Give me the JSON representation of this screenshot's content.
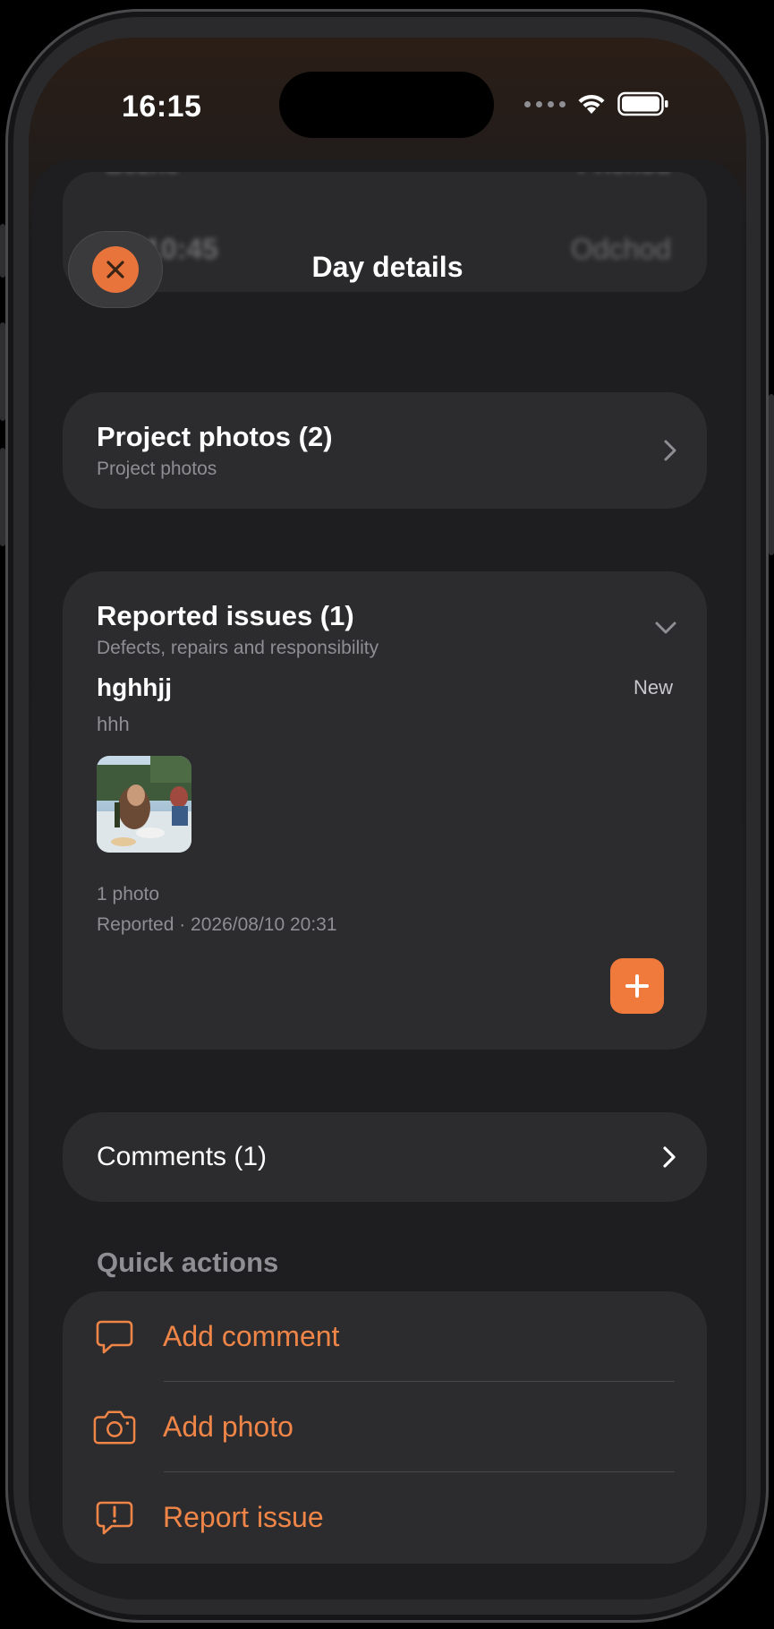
{
  "status_bar": {
    "time": "16:15"
  },
  "background": {
    "left_blur": "10:45",
    "right_blur": "Odchod",
    "top_left_blur": "Běžné",
    "top_right_blur": "Příchod"
  },
  "header": {
    "title": "Day details",
    "close_icon": "close-icon"
  },
  "project_photos": {
    "title": "Project photos (2)",
    "subtitle": "Project photos",
    "icon": "chevron-right-icon"
  },
  "reported_issues": {
    "title": "Reported issues (1)",
    "subtitle": "Defects, repairs and responsibility",
    "icon": "chevron-down-icon",
    "issue": {
      "name": "hghhjj",
      "status": "New",
      "description": "hhh",
      "photo_count": "1 photo",
      "reported": "Reported · 2026/08/10 20:31"
    },
    "add_icon": "plus-icon"
  },
  "comments": {
    "label": "Comments (1)",
    "icon": "chevron-right-icon"
  },
  "quick_actions": {
    "title": "Quick actions",
    "items": [
      {
        "label": "Add comment",
        "icon": "comment-icon"
      },
      {
        "label": "Add photo",
        "icon": "camera-icon"
      },
      {
        "label": "Report issue",
        "icon": "report-issue-icon"
      }
    ]
  },
  "colors": {
    "accent": "#f07a3c",
    "background": "#1e1e20",
    "card": "#2c2c2e",
    "secondary_text": "#8e8e93"
  }
}
